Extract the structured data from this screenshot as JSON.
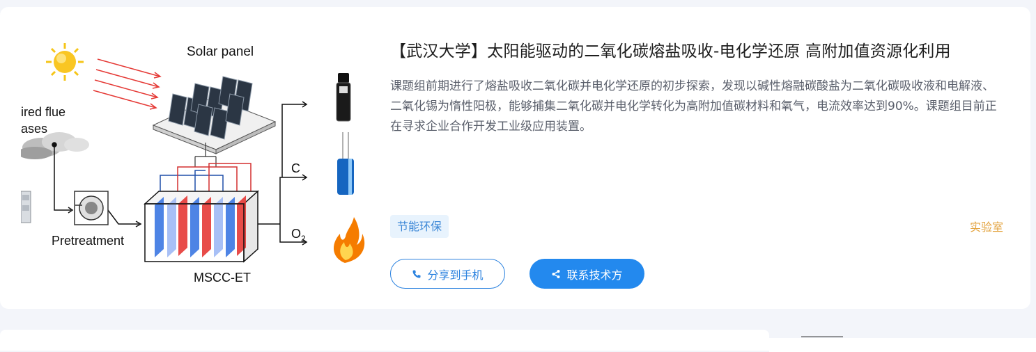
{
  "card": {
    "title": "【武汉大学】太阳能驱动的二氧化碳熔盐吸收-电化学还原 高附加值资源化利用",
    "description": "课题组前期进行了熔盐吸收二氧化碳并电化学还原的初步探索，发现以碱性熔融碳酸盐为二氧化碳吸收液和电解液、二氧化锡为惰性阳极，能够捕集二氧化碳并电化学转化为高附加值碳材料和氧气，电流效率达到90%。课题组目前正在寻求企业合作开发工业级应用装置。",
    "tag": "节能环保",
    "category": "实验室",
    "share_button": "分享到手机",
    "contact_button": "联系技术方",
    "colors": {
      "primary": "#2389ee",
      "tag_bg": "#e8f3fd",
      "category": "#e3a23c"
    }
  },
  "figure": {
    "solar_panel_label": "Solar panel",
    "flue_label_line1": "ired flue",
    "flue_label_line2": "ases",
    "pretreatment_label": "Pretreatment",
    "cell_label": "MSCC-ET",
    "carbon_label": "C",
    "oxygen_label": "O",
    "oxygen_subscript": "2",
    "icons": [
      "sun-icon",
      "solar-panel-icon",
      "cloud-icon",
      "factory-icon",
      "pretreatment-icon",
      "electrolysis-cell-icon",
      "carbon-vial-icon",
      "capacitor-icon",
      "flame-icon"
    ]
  }
}
